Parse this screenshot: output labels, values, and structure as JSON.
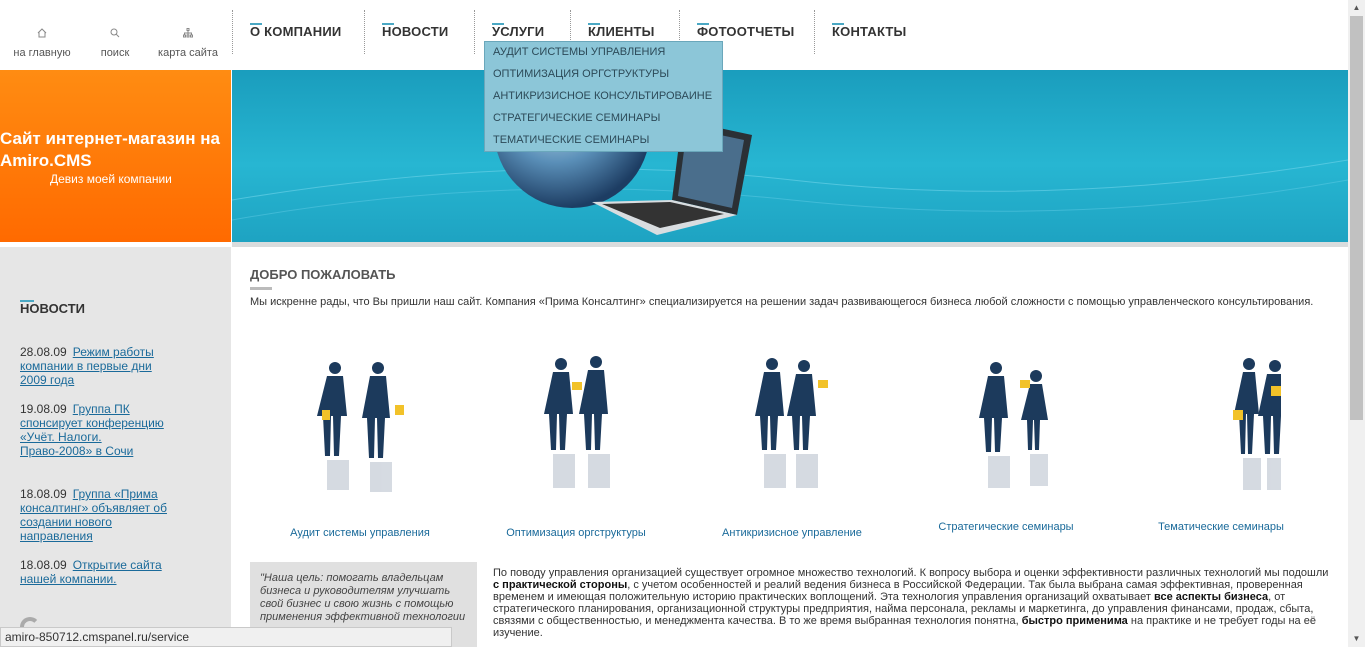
{
  "util_nav": [
    {
      "label": "на главную",
      "icon": "home-icon"
    },
    {
      "label": "поиск",
      "icon": "search-icon"
    },
    {
      "label": "карта сайта",
      "icon": "sitemap-icon"
    }
  ],
  "main_nav": [
    {
      "label": "О КОМПАНИИ"
    },
    {
      "label": "НОВОСТИ"
    },
    {
      "label": "УСЛУГИ"
    },
    {
      "label": "КЛИЕНТЫ"
    },
    {
      "label": "ФОТООТЧЕТЫ"
    },
    {
      "label": "КОНТАКТЫ"
    }
  ],
  "dropdown": [
    "АУДИТ СИСТЕМЫ УПРАВЛЕНИЯ",
    "ОПТИМИЗАЦИЯ ОРГСТРУКТУРЫ",
    "АНТИКРИЗИСНОЕ КОНСУЛЬТИРОВАИНЕ",
    "СТРАТЕГИЧЕСКИЕ СЕМИНАРЫ",
    "ТЕМАТИЧЕСКИЕ СЕМИНАРЫ"
  ],
  "header": {
    "title": "Сайт интернет-магазин на Amiro.CMS",
    "motto": "Девиз моей компании"
  },
  "sidebar": {
    "title": "НОВОСТИ",
    "news": [
      {
        "date": "28.08.09",
        "text": "Режим работы компании в первые дни 2009 года"
      },
      {
        "date": "19.08.09",
        "text": "Группа ПК спонсирует конференцию «Учёт. Налоги. Право-2008» в Сочи"
      },
      {
        "date": "18.08.09",
        "text": "Группа «Прима консалтинг» объявляет об создании нового направления"
      },
      {
        "date": "18.08.09",
        "text": "Открытие сайта нашей компании."
      }
    ]
  },
  "main": {
    "welcome_title": "ДОБРО ПОЖАЛОВАТЬ",
    "intro": "Мы искренне рады, что Вы пришли наш сайт. Компания «Прима Консалтинг» специализируется на решении задач развивающегося бизнеса любой сложности с помощью управленческого консультирования.",
    "services": [
      {
        "label": "Аудит системы управления"
      },
      {
        "label": "Оптимизация оргструктуры"
      },
      {
        "label": "Антикризисное управление"
      },
      {
        "label": "Стратегические семинары"
      },
      {
        "label": "Тематические семинары"
      }
    ],
    "quote": "\"Наша цель: помогать владельцам бизнеса и руководителям улучшать свой бизнес и свою жизнь с помощью применения эффективной технологии",
    "body_1": "По поводу управления организацией существует огромное множество технологий. К вопросу выбора и оценки эффективности различных технологий мы подошли",
    "body_2": "с практической стороны",
    "body_3": ", с учетом особенностей и реалий ведения бизнеса в Российской Федерации. Так была выбрана самая эффективная, проверенная временем и имеющая положительную историю практических воплощений. Эта технология управления организаций охватывает",
    "body_4": "все аспекты бизнеса",
    "body_5": ", от стратегического планирования, организационной структуры предприятия, найма персонала, рекламы и маркетинга, до управления финансами, продаж, сбыта, связями с общественностью, и менеджмента качества. В то же время выбранная технология понятна,",
    "body_6": "быстро применима",
    "body_7": "на практике и не требует годы на её изучение."
  },
  "status_bar": "amiro-850712.cmspanel.ru/service",
  "colors": {
    "accent": "#4aa8c4",
    "orange": "#ff7a00",
    "banner": "#1ea3c2",
    "dropdown_bg": "#8cc6d8",
    "link": "#1a6a9a"
  }
}
